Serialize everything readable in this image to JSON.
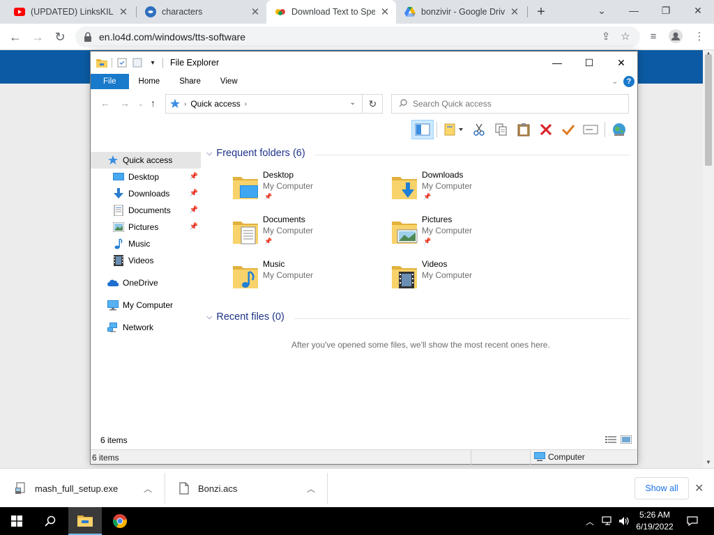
{
  "browser": {
    "tabs": [
      {
        "title": "(UPDATED) LinksKILL (I...",
        "favicon": "youtube-icon"
      },
      {
        "title": "characters",
        "favicon": "trello-icon"
      },
      {
        "title": "Download Text to Spee",
        "favicon": "lo4d-icon",
        "active": true
      },
      {
        "title": "bonzivir - Google Drive",
        "favicon": "google-drive-icon"
      }
    ],
    "url": "en.lo4d.com/windows/tts-software"
  },
  "explorer": {
    "title": "File Explorer",
    "ribbon_tabs": [
      "File",
      "Home",
      "Share",
      "View"
    ],
    "breadcrumb": "Quick access",
    "search_placeholder": "Search Quick access",
    "nav": {
      "quick_access": "Quick access",
      "pinned": [
        "Desktop",
        "Downloads",
        "Documents",
        "Pictures"
      ],
      "music": "Music",
      "videos": "Videos",
      "onedrive": "OneDrive",
      "my_computer": "My Computer",
      "network": "Network"
    },
    "frequent_header": "Frequent folders (6)",
    "folders": [
      {
        "name": "Desktop",
        "location": "My Computer",
        "pinned": true
      },
      {
        "name": "Downloads",
        "location": "My Computer",
        "pinned": true
      },
      {
        "name": "Documents",
        "location": "My Computer",
        "pinned": true
      },
      {
        "name": "Pictures",
        "location": "My Computer",
        "pinned": true
      },
      {
        "name": "Music",
        "location": "My Computer",
        "pinned": false
      },
      {
        "name": "Videos",
        "location": "My Computer",
        "pinned": false
      }
    ],
    "recent_header": "Recent files (0)",
    "recent_empty": "After you've opened some files, we'll show the most recent ones here.",
    "item_count": "6 items",
    "status_left": "6 items",
    "status_right": "Computer"
  },
  "downloads": {
    "items": [
      {
        "name": "mash_full_setup.exe"
      },
      {
        "name": "Bonzi.acs"
      }
    ],
    "show_all": "Show all"
  },
  "taskbar": {
    "time": "5:26 AM",
    "date": "6/19/2022"
  },
  "colors": {
    "chrome_tabstrip": "#dee1e6",
    "explorer_accent": "#1979ca",
    "group_header": "#1e3287",
    "page_banner": "#0b5aa3"
  }
}
